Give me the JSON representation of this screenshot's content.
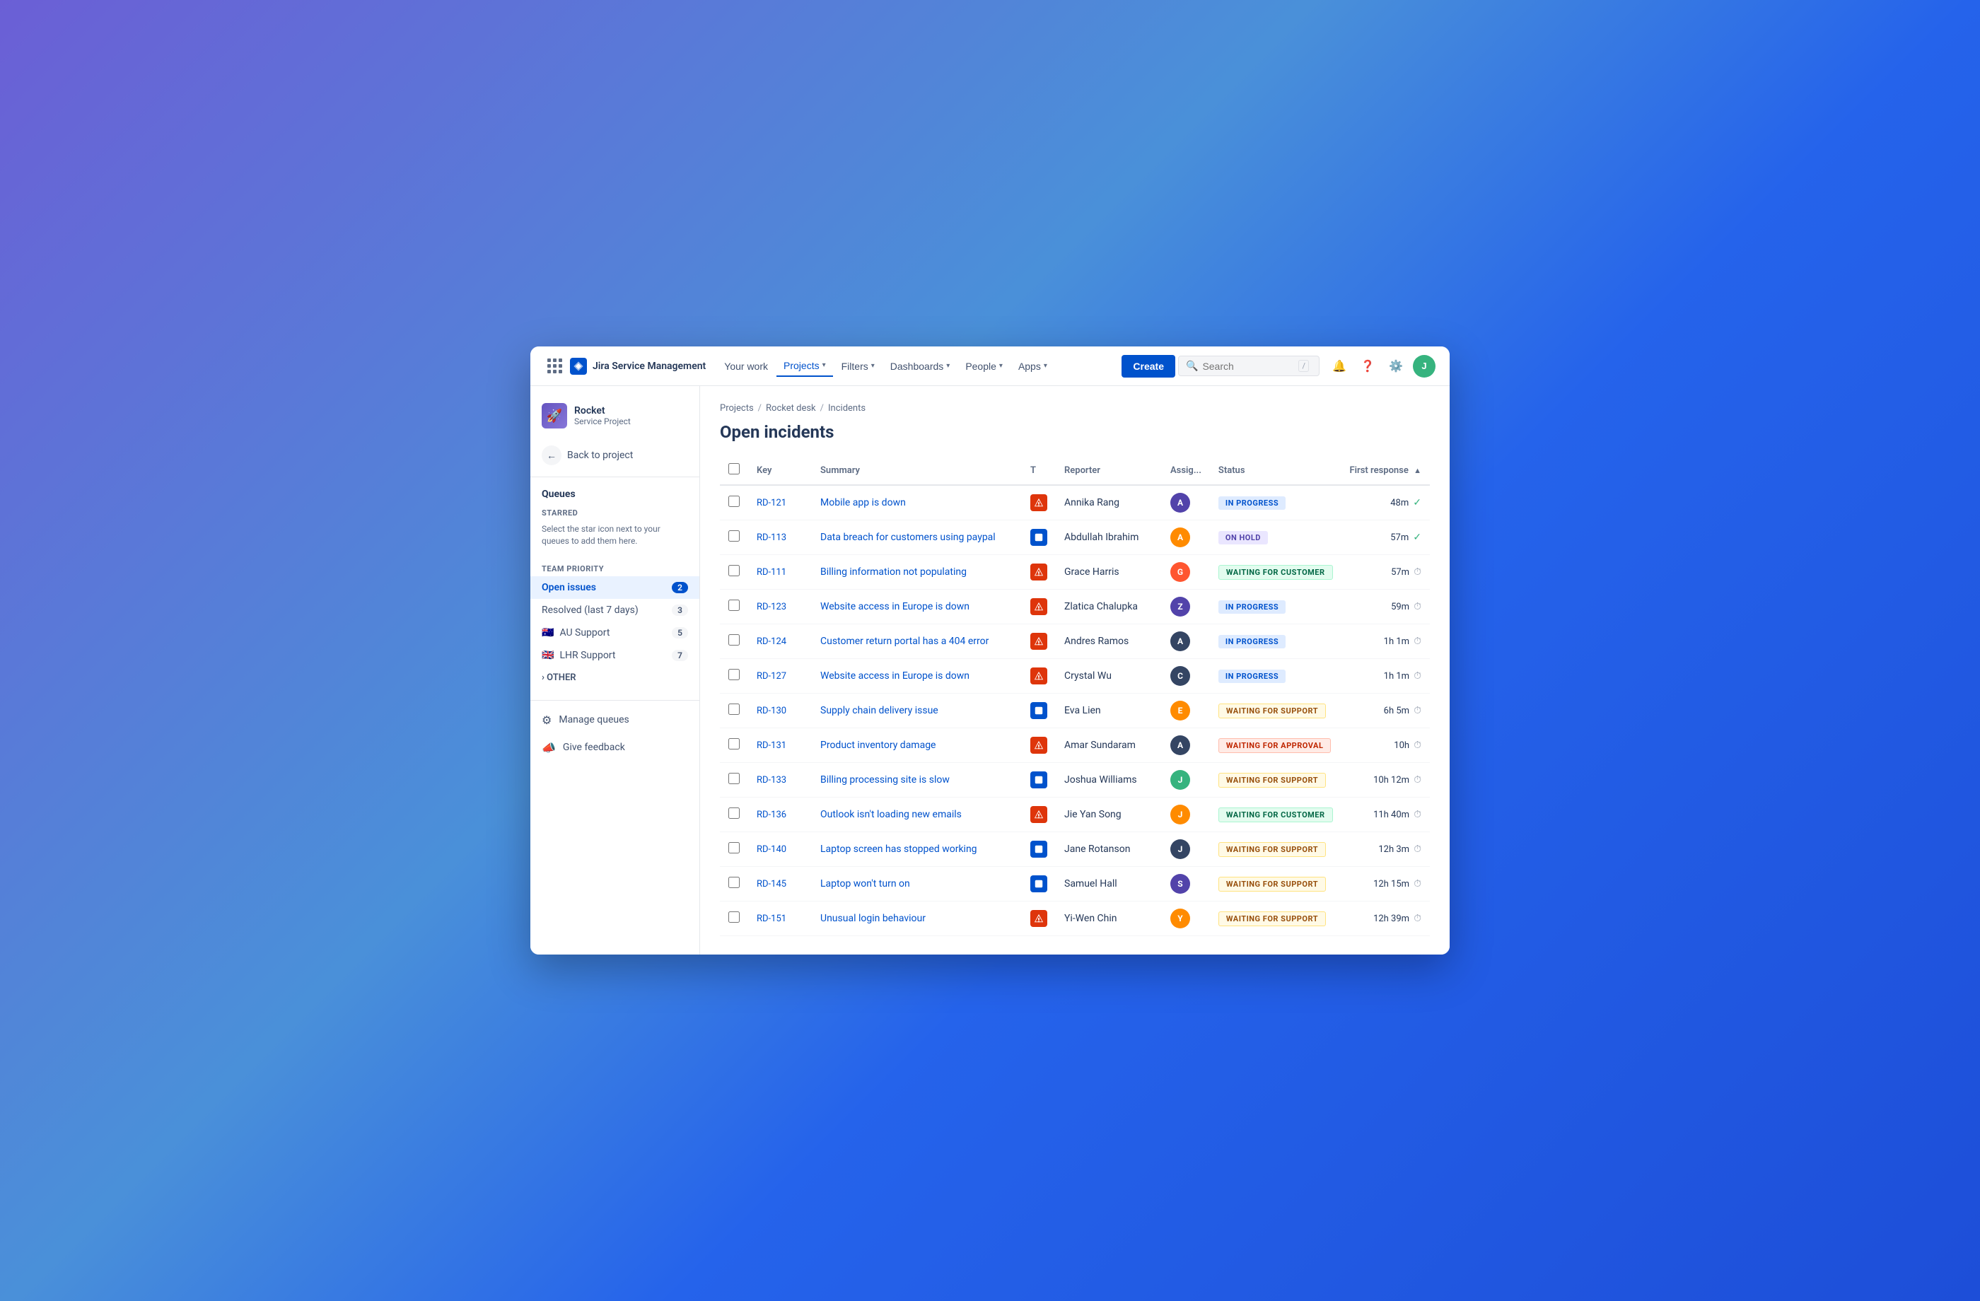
{
  "app": {
    "name": "Jira Service Management",
    "logo_text": "Jira Service Management"
  },
  "nav": {
    "your_work": "Your work",
    "projects": "Projects",
    "filters": "Filters",
    "dashboards": "Dashboards",
    "people": "People",
    "apps": "Apps",
    "create": "Create",
    "search_placeholder": "Search"
  },
  "project": {
    "icon": "🚀",
    "name": "Rocket",
    "type": "Service Project",
    "back_label": "Back to project"
  },
  "sidebar": {
    "queues_heading": "Queues",
    "starred_title": "STARRED",
    "starred_desc": "Select the star icon next to your queues to add them here.",
    "team_priority_title": "TEAM PRIORITY",
    "items": [
      {
        "label": "Open issues",
        "count": "2",
        "active": true
      },
      {
        "label": "Resolved (last 7 days)",
        "count": "3",
        "active": false
      },
      {
        "label": "AU Support",
        "count": "5",
        "active": false,
        "flag": "🇦🇺"
      },
      {
        "label": "LHR Support",
        "count": "7",
        "active": false,
        "flag": "🇬🇧"
      }
    ],
    "other_toggle": "› OTHER",
    "manage_queues": "Manage queues",
    "give_feedback": "Give feedback"
  },
  "breadcrumb": {
    "items": [
      "Projects",
      "Rocket desk",
      "Incidents"
    ]
  },
  "page": {
    "title": "Open incidents"
  },
  "table": {
    "headers": {
      "key": "Key",
      "summary": "Summary",
      "type": "T",
      "reporter": "Reporter",
      "assignee": "Assig...",
      "status": "Status",
      "first_response": "First response"
    },
    "rows": [
      {
        "id": "RD-121",
        "summary": "Mobile app is down",
        "type": "incident",
        "reporter": "Annika Rang",
        "assignee_color": "#5243AA",
        "assignee_initials": "A",
        "status": "IN PROGRESS",
        "status_class": "status-in-progress",
        "first_response": "48m",
        "fr_done": true
      },
      {
        "id": "RD-113",
        "summary": "Data breach for customers using paypal",
        "type": "service",
        "reporter": "Abdullah Ibrahim",
        "assignee_color": "#FF8B00",
        "assignee_initials": "A",
        "status": "ON HOLD",
        "status_class": "status-on-hold",
        "first_response": "57m",
        "fr_done": true
      },
      {
        "id": "RD-111",
        "summary": "Billing information not populating",
        "type": "incident",
        "reporter": "Grace Harris",
        "assignee_color": "#FF5630",
        "assignee_initials": "G",
        "status": "WAITING FOR CUSTOMER",
        "status_class": "status-waiting-customer",
        "first_response": "57m",
        "fr_done": false
      },
      {
        "id": "RD-123",
        "summary": "Website access in Europe is down",
        "type": "incident",
        "reporter": "Zlatica Chalupka",
        "assignee_color": "#5243AA",
        "assignee_initials": "Z",
        "status": "IN PROGRESS",
        "status_class": "status-in-progress",
        "first_response": "59m",
        "fr_done": false
      },
      {
        "id": "RD-124",
        "summary": "Customer return portal has a 404 error",
        "type": "incident",
        "reporter": "Andres Ramos",
        "assignee_color": "#344563",
        "assignee_initials": "A",
        "status": "IN PROGRESS",
        "status_class": "status-in-progress",
        "first_response": "1h 1m",
        "fr_done": false
      },
      {
        "id": "RD-127",
        "summary": "Website access in Europe is down",
        "type": "incident",
        "reporter": "Crystal Wu",
        "assignee_color": "#344563",
        "assignee_initials": "C",
        "status": "IN PROGRESS",
        "status_class": "status-in-progress",
        "first_response": "1h 1m",
        "fr_done": false
      },
      {
        "id": "RD-130",
        "summary": "Supply chain delivery issue",
        "type": "service",
        "reporter": "Eva Lien",
        "assignee_color": "#FF8B00",
        "assignee_initials": "E",
        "status": "WAITING FOR SUPPORT",
        "status_class": "status-waiting-support",
        "first_response": "6h 5m",
        "fr_done": false
      },
      {
        "id": "RD-131",
        "summary": "Product inventory damage",
        "type": "incident",
        "reporter": "Amar Sundaram",
        "assignee_color": "#344563",
        "assignee_initials": "A",
        "status": "WAITING FOR APPROVAL",
        "status_class": "status-waiting-approval",
        "first_response": "10h",
        "fr_done": false
      },
      {
        "id": "RD-133",
        "summary": "Billing processing site is slow",
        "type": "service",
        "reporter": "Joshua Williams",
        "assignee_color": "#36B37E",
        "assignee_initials": "J",
        "status": "WAITING FOR SUPPORT",
        "status_class": "status-waiting-support",
        "first_response": "10h 12m",
        "fr_done": false
      },
      {
        "id": "RD-136",
        "summary": "Outlook isn't loading new emails",
        "type": "incident",
        "reporter": "Jie Yan Song",
        "assignee_color": "#FF8B00",
        "assignee_initials": "J",
        "status": "WAITING FOR CUSTOMER",
        "status_class": "status-waiting-customer",
        "first_response": "11h 40m",
        "fr_done": false
      },
      {
        "id": "RD-140",
        "summary": "Laptop screen has stopped working",
        "type": "service",
        "reporter": "Jane Rotanson",
        "assignee_color": "#344563",
        "assignee_initials": "J",
        "status": "WAITING FOR SUPPORT",
        "status_class": "status-waiting-support",
        "first_response": "12h 3m",
        "fr_done": false
      },
      {
        "id": "RD-145",
        "summary": "Laptop won't turn on",
        "type": "service",
        "reporter": "Samuel Hall",
        "assignee_color": "#5243AA",
        "assignee_initials": "S",
        "status": "WAITING FOR SUPPORT",
        "status_class": "status-waiting-support",
        "first_response": "12h 15m",
        "fr_done": false
      },
      {
        "id": "RD-151",
        "summary": "Unusual login behaviour",
        "type": "incident",
        "reporter": "Yi-Wen Chin",
        "assignee_color": "#FF8B00",
        "assignee_initials": "Y",
        "status": "WAITING FOR SUPPORT",
        "status_class": "status-waiting-support",
        "first_response": "12h 39m",
        "fr_done": false
      }
    ]
  }
}
